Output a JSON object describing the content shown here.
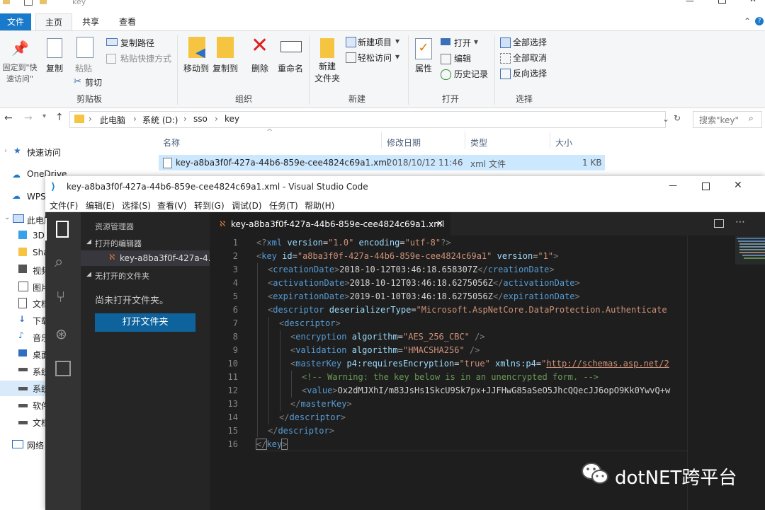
{
  "explorer": {
    "title": "key",
    "tabs": [
      "文件",
      "主页",
      "共享",
      "查看"
    ],
    "ribbon": {
      "pin_label": "固定到\"快速访问\"",
      "copy_label": "复制",
      "paste_label": "粘贴",
      "copy_path_label": "复制路径",
      "paste_shortcut_label": "粘贴快捷方式",
      "cut_label": "剪切",
      "clipboard_group": "剪贴板",
      "move_to_label": "移动到",
      "copy_to_label": "复制到",
      "delete_label": "删除",
      "rename_label": "重命名",
      "organize_group": "组织",
      "new_folder_label": "新建\n文件夹",
      "new_item_label": "新建项目",
      "easy_access_label": "轻松访问",
      "new_group": "新建",
      "properties_label": "属性",
      "open_label": "打开",
      "edit_label": "编辑",
      "history_label": "历史记录",
      "open_group": "打开",
      "select_all_label": "全部选择",
      "select_none_label": "全部取消",
      "invert_label": "反向选择",
      "select_group": "选择"
    },
    "breadcrumb": [
      "此电脑",
      "系统 (D:)",
      "sso",
      "key"
    ],
    "search_placeholder": "搜索\"key\"",
    "columns": [
      "名称",
      "修改日期",
      "类型",
      "大小"
    ],
    "file": {
      "name": "key-a8ba3f0f-427a-44b6-859e-cee4824c69a1.xml",
      "date": "2018/10/12 11:46",
      "type": "xml 文件",
      "size": "1 KB"
    },
    "nav": [
      "快速访问",
      "OneDrive",
      "WPS",
      "此电脑",
      "3D",
      "Sha",
      "视频",
      "图片",
      "文档",
      "下载",
      "音乐",
      "桌面",
      "系统",
      "系统",
      "软件",
      "文档",
      "网络"
    ]
  },
  "vscode": {
    "title": "key-a8ba3f0f-427a-44b6-859e-cee4824c69a1.xml - Visual Studio Code",
    "menu": [
      "文件(F)",
      "编辑(E)",
      "选择(S)",
      "查看(V)",
      "转到(G)",
      "调试(D)",
      "任务(T)",
      "帮助(H)"
    ],
    "sidebar": {
      "header": "资源管理器",
      "open_editors": "打开的编辑器",
      "open_file": "key-a8ba3f0f-427a-4...",
      "no_folder": "无打开的文件夹",
      "no_folder_msg": "尚未打开文件夹。",
      "open_folder_button": "打开文件夹"
    },
    "tab_label": "key-a8ba3f0f-427a-44b6-859e-cee4824c69a1.xml",
    "line_numbers": [
      "1",
      "2",
      "3",
      "4",
      "5",
      "6",
      "7",
      "8",
      "9",
      "10",
      "11",
      "12",
      "13",
      "14",
      "15",
      "16"
    ],
    "code": {
      "l1": [
        "<?",
        "xml",
        " version",
        "=",
        "\"1.0\"",
        " encoding",
        "=",
        "\"utf-8\"",
        "?>"
      ],
      "l2": [
        "<",
        "key",
        " id",
        "=",
        "\"a8ba3f0f-427a-44b6-859e-cee4824c69a1\"",
        " version",
        "=",
        "\"1\"",
        ">"
      ],
      "l3": [
        "<",
        "creationDate",
        ">",
        "2018-10-12T03:46:18.658307Z",
        "</",
        "creationDate",
        ">"
      ],
      "l4": [
        "<",
        "activationDate",
        ">",
        "2018-10-12T03:46:18.6275056Z",
        "</",
        "activationDate",
        ">"
      ],
      "l5": [
        "<",
        "expirationDate",
        ">",
        "2019-01-10T03:46:18.6275056Z",
        "</",
        "expirationDate",
        ">"
      ],
      "l6": [
        "<",
        "descriptor",
        " deserializerType",
        "=",
        "\"Microsoft.AspNetCore.DataProtection.Authenticate"
      ],
      "l7": [
        "<",
        "descriptor",
        ">"
      ],
      "l8": [
        "<",
        "encryption",
        " algorithm",
        "=",
        "\"AES_256_CBC\"",
        " />"
      ],
      "l9": [
        "<",
        "validation",
        " algorithm",
        "=",
        "\"HMACSHA256\"",
        " />"
      ],
      "l10": [
        "<",
        "masterKey",
        " p4:requiresEncryption",
        "=",
        "\"true\"",
        " xmlns:p4",
        "=",
        "\"",
        "http://schemas.asp.net/2"
      ],
      "l11": [
        "<!-- Warning: the key below is in an unencrypted form. -->"
      ],
      "l12": [
        "<",
        "value",
        ">",
        "Ox2dMJXhI/m83JsHs1SkcU9Sk7px+JJFHwG85aSeO5JhcQQecJJ6opO9Kk0YwvQ+w"
      ],
      "l13": [
        "</",
        "masterKey",
        ">"
      ],
      "l14": [
        "</",
        "descriptor",
        ">"
      ],
      "l15": [
        "</",
        "descriptor",
        ">"
      ],
      "l16": [
        "</",
        "key",
        ">"
      ]
    }
  },
  "watermark": "dotNET跨平台",
  "colors": {
    "explorer_accent": "#1979ca",
    "vsc_bg": "#1e1e1e",
    "vsc_button": "#0e639c"
  }
}
